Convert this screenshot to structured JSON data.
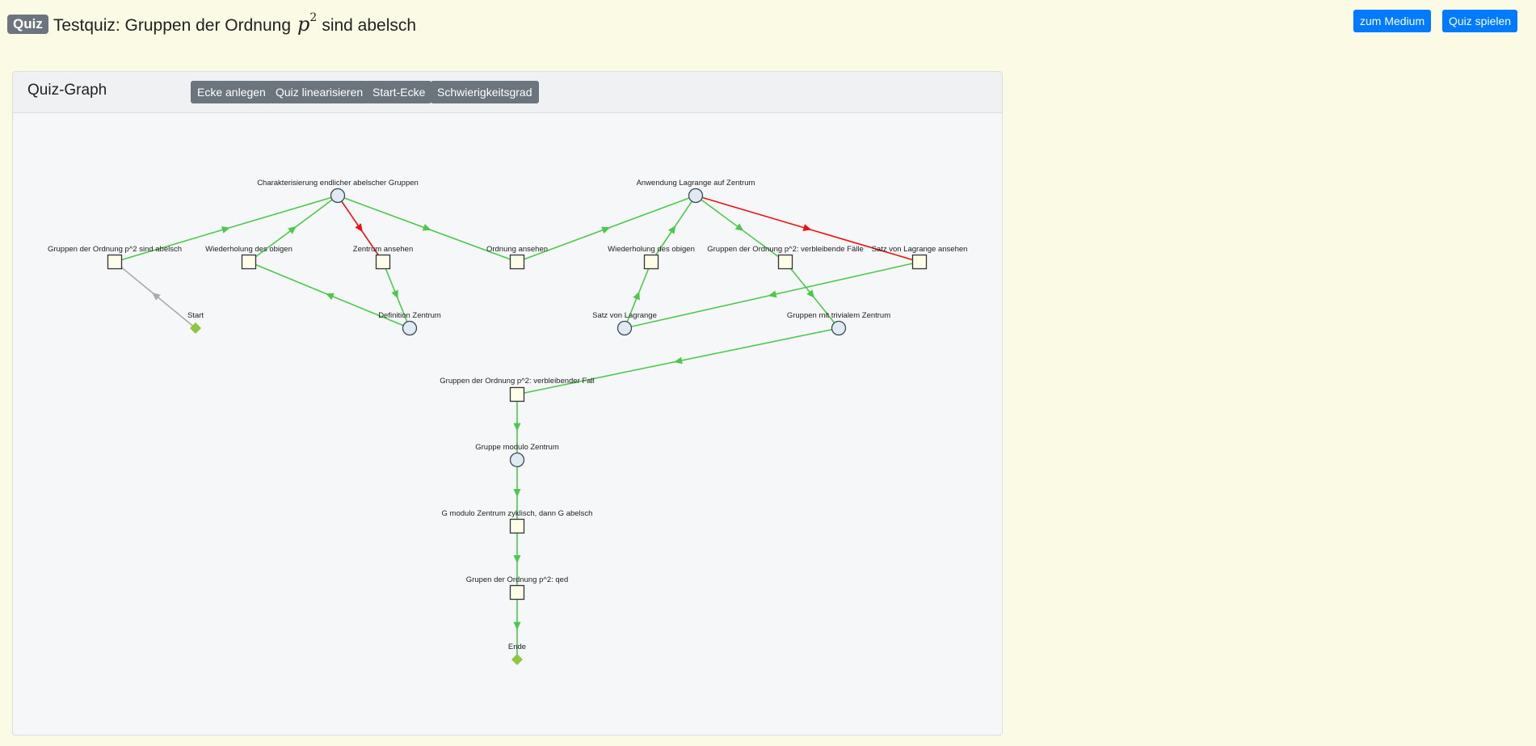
{
  "header": {
    "badge": "Quiz",
    "title_prefix": "Testquiz: Gruppen der Ordnung",
    "math_var": "p",
    "math_exp": "2",
    "title_suffix": "sind abelsch"
  },
  "top_buttons": {
    "medium": "zum Medium",
    "play": "Quiz spielen"
  },
  "panel": {
    "title": "Quiz-Graph",
    "buttons": [
      "Ecke anlegen",
      "Quiz linearisieren",
      "Start-Ecke",
      "Schwierigkeitsgrad"
    ]
  },
  "colors": {
    "edge_green": "#4cc94c",
    "edge_red": "#ee1111",
    "edge_gray": "#aaaaaa",
    "start_end": "#8dc63f",
    "node_fill": "#fdfde8",
    "circle_fill": "#dfeaf2"
  },
  "graph": {
    "nodes": [
      {
        "id": "char",
        "shape": "circle",
        "label": "Charakterisierung endlicher abelscher Gruppen"
      },
      {
        "id": "anw",
        "shape": "circle",
        "label": "Anwendung Lagrange auf Zentrum"
      },
      {
        "id": "gp2",
        "shape": "square",
        "label": "Gruppen der Ordnung p^2 sind abelsch"
      },
      {
        "id": "wied1",
        "shape": "square",
        "label": "Wiederholung des obigen"
      },
      {
        "id": "zent",
        "shape": "square",
        "label": "Zentrum ansehen"
      },
      {
        "id": "ord",
        "shape": "square",
        "label": "Ordnung ansehen"
      },
      {
        "id": "wied2",
        "shape": "square",
        "label": "Wiederholung des obigen"
      },
      {
        "id": "gvf",
        "shape": "square",
        "label": "Gruppen der Ordnung p^2: verbleibende Fälle"
      },
      {
        "id": "slag",
        "shape": "square",
        "label": "Satz von Lagrange ansehen"
      },
      {
        "id": "start",
        "shape": "diamond",
        "label": "Start"
      },
      {
        "id": "defz",
        "shape": "circle",
        "label": "Definition Zentrum"
      },
      {
        "id": "satz",
        "shape": "circle",
        "label": "Satz von Lagrange"
      },
      {
        "id": "gtz",
        "shape": "circle",
        "label": "Gruppen mit trivialem Zentrum"
      },
      {
        "id": "gvf1",
        "shape": "square",
        "label": "Gruppen der Ordnung p^2: verbleibender Fall"
      },
      {
        "id": "gmz",
        "shape": "circle",
        "label": "Gruppe modulo Zentrum"
      },
      {
        "id": "gzyk",
        "shape": "square",
        "label": "G modulo Zentrum zyklisch, dann G abelsch"
      },
      {
        "id": "qed",
        "shape": "square",
        "label": "Grupen der Ordnung p^2: qed"
      },
      {
        "id": "ende",
        "shape": "diamond",
        "label": "Ende"
      }
    ],
    "edges": [
      {
        "from": "start",
        "to": "gp2",
        "color": "gray"
      },
      {
        "from": "gp2",
        "to": "char",
        "color": "green"
      },
      {
        "from": "wied1",
        "to": "char",
        "color": "green"
      },
      {
        "from": "char",
        "to": "zent",
        "color": "red"
      },
      {
        "from": "char",
        "to": "ord",
        "color": "green"
      },
      {
        "from": "zent",
        "to": "defz",
        "color": "green"
      },
      {
        "from": "defz",
        "to": "wied1",
        "color": "green"
      },
      {
        "from": "ord",
        "to": "anw",
        "color": "green"
      },
      {
        "from": "wied2",
        "to": "anw",
        "color": "green"
      },
      {
        "from": "anw",
        "to": "gvf",
        "color": "green"
      },
      {
        "from": "anw",
        "to": "slag",
        "color": "red"
      },
      {
        "from": "satz",
        "to": "wied2",
        "color": "green"
      },
      {
        "from": "slag",
        "to": "satz",
        "color": "green"
      },
      {
        "from": "gvf",
        "to": "gtz",
        "color": "green"
      },
      {
        "from": "gtz",
        "to": "gvf1",
        "color": "green"
      },
      {
        "from": "gvf1",
        "to": "gmz",
        "color": "green"
      },
      {
        "from": "gmz",
        "to": "gzyk",
        "color": "green"
      },
      {
        "from": "gzyk",
        "to": "qed",
        "color": "green"
      },
      {
        "from": "qed",
        "to": "ende",
        "color": "green"
      }
    ]
  }
}
